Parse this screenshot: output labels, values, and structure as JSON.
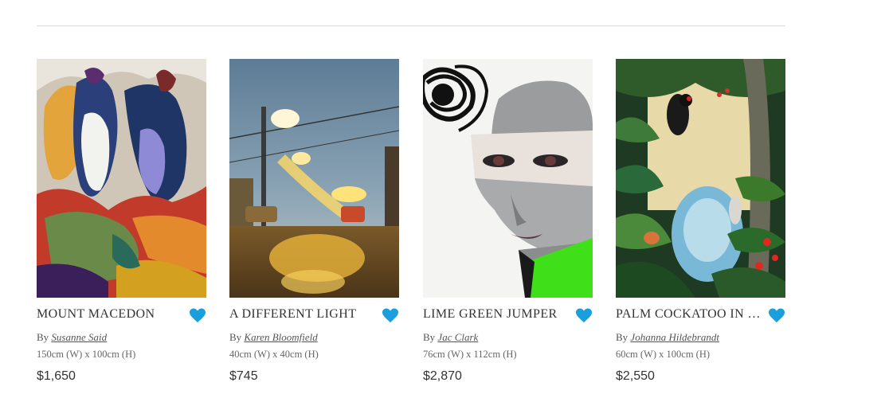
{
  "artworks": [
    {
      "title": "MOUNT MACEDON",
      "by": "By",
      "artist": "Susanne Said",
      "dimensions": "150cm (W) x 100cm (H)",
      "price": "$1,650"
    },
    {
      "title": "A DIFFERENT LIGHT",
      "by": "By",
      "artist": "Karen Bloomfield",
      "dimensions": "40cm (W) x 40cm (H)",
      "price": "$745"
    },
    {
      "title": "LIME GREEN JUMPER",
      "by": "By",
      "artist": "Jac Clark",
      "dimensions": "76cm (W) x 112cm (H)",
      "price": "$2,870"
    },
    {
      "title": "PALM COCKATOO IN …",
      "by": "By",
      "artist": "Johanna Hildebrandt",
      "dimensions": "60cm (W) x 100cm (H)",
      "price": "$2,550"
    }
  ],
  "colors": {
    "heart": "#1a9fdc",
    "divider": "#d8d8d8",
    "text": "#333333"
  },
  "icons": {
    "favorite": "heart-icon"
  }
}
